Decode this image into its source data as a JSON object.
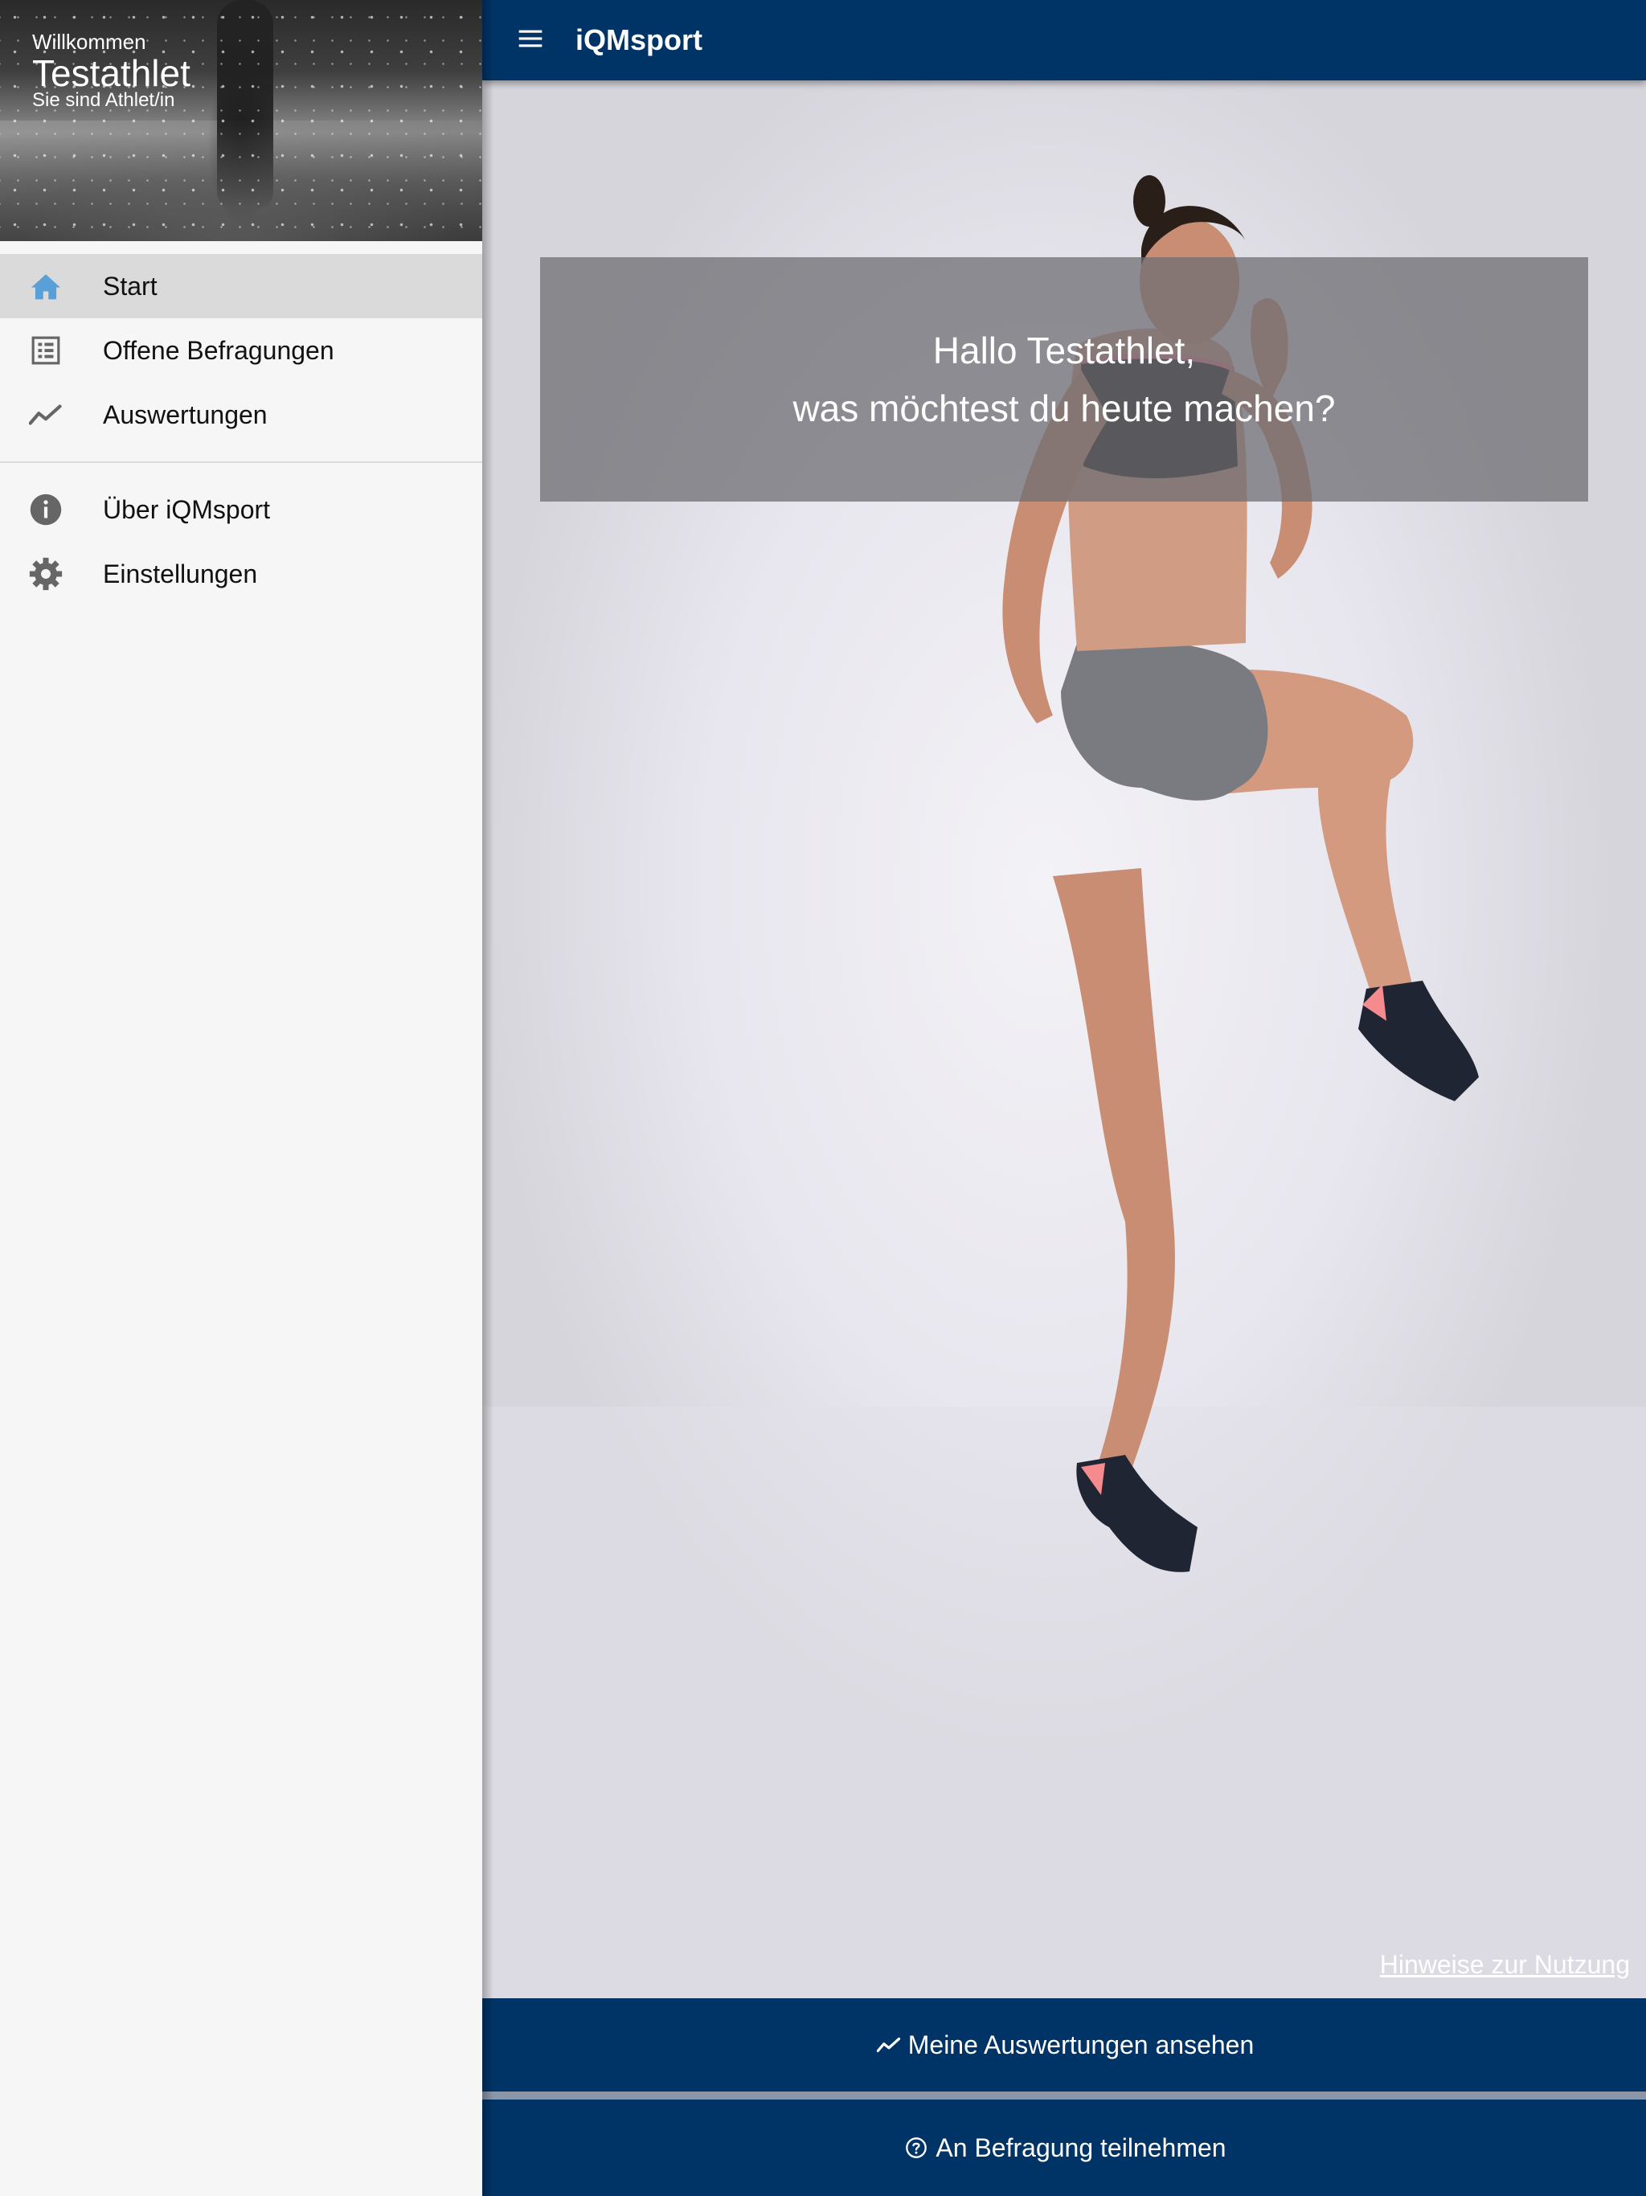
{
  "app": {
    "title": "iQMsport"
  },
  "drawer": {
    "welcome": "Willkommen",
    "user_name": "Testathlet",
    "role": "Sie sind Athlet/in"
  },
  "nav": {
    "items": [
      {
        "label": "Start",
        "icon": "home-icon",
        "active": true
      },
      {
        "label": "Offene Befragungen",
        "icon": "list-icon"
      },
      {
        "label": "Auswertungen",
        "icon": "trending-icon"
      },
      {
        "label": "Über iQMsport",
        "icon": "info-icon"
      },
      {
        "label": "Einstellungen",
        "icon": "gear-icon"
      }
    ]
  },
  "main": {
    "greeting_line1": "Hallo Testathlet,",
    "greeting_line2": "was möchtest du heute machen?",
    "hint_link": "Hinweise zur Nutzung",
    "buttons": {
      "evaluations": "Meine Auswertungen ansehen",
      "survey": "An Befragung teilnehmen"
    }
  },
  "colors": {
    "primary": "#003366",
    "active_icon": "#5aa0d8",
    "nav_icon": "#666666"
  }
}
